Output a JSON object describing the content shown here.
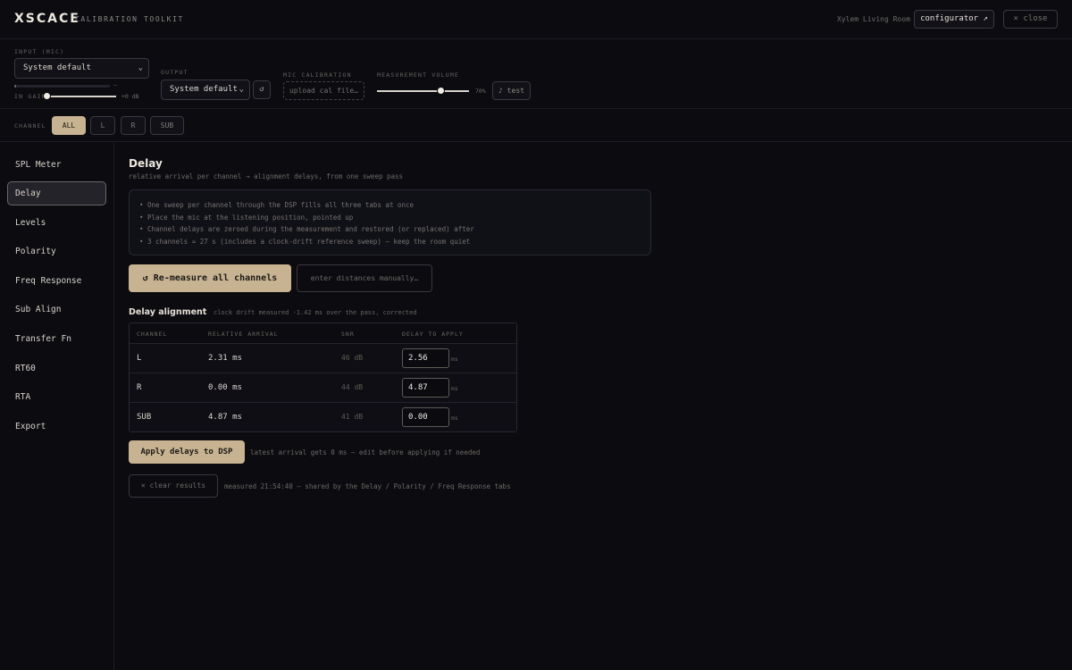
{
  "header": {
    "logo": "XSCACE",
    "subtitle": "CALIBRATION TOOLKIT",
    "room": "Xylem Living Room",
    "configurator_label": "configurator ↗",
    "close_label": "× close"
  },
  "controls": {
    "input_label": "INPUT (MIC)",
    "input_value": "System default",
    "input_meter_fraction": 0.02,
    "input_meter_dash": "—",
    "in_gain_label": "IN GAIN",
    "in_gain_value": "+0 dB",
    "output_label": "OUTPUT",
    "output_value": "System default",
    "refresh_icon": "↺",
    "mic_cal_label": "MIC CALIBRATION",
    "mic_cal_button": "upload cal file…",
    "volume_label": "MEASUREMENT VOLUME",
    "volume_value": "70%",
    "volume_fraction": 0.7,
    "test_label": "♪ test"
  },
  "channels": {
    "label": "CHANNEL",
    "items": [
      "ALL",
      "L",
      "R",
      "SUB"
    ],
    "active": "ALL"
  },
  "sidebar": {
    "items": [
      "SPL Meter",
      "Delay",
      "Levels",
      "Polarity",
      "Freq Response",
      "Sub Align",
      "Transfer Fn",
      "RT60",
      "RTA",
      "Export"
    ],
    "active": "Delay"
  },
  "main": {
    "title": "Delay",
    "subtitle": "relative arrival per channel → alignment delays, from one sweep pass",
    "info": [
      "• One sweep per channel through the DSP fills all three tabs at once",
      "• Place the mic at the listening position, pointed up",
      "• Channel delays are zeroed during the measurement and restored (or replaced) after",
      "• 3 channels ≈ 27 s (includes a clock-drift reference sweep) — keep the room quiet"
    ],
    "remeasure_label": "↺ Re-measure all channels",
    "manual_label": "enter distances manually…",
    "alignment_title": "Delay alignment",
    "alignment_note": "clock drift measured -1.42 ms over the pass, corrected",
    "table": {
      "headers": [
        "CHANNEL",
        "RELATIVE ARRIVAL",
        "SNR",
        "DELAY TO APPLY"
      ],
      "rows": [
        {
          "channel": "L",
          "arrival": "2.31 ms",
          "snr": "46 dB",
          "delay": "2.56",
          "unit": "ms"
        },
        {
          "channel": "R",
          "arrival": "0.00 ms",
          "snr": "44 dB",
          "delay": "4.87",
          "unit": "ms"
        },
        {
          "channel": "SUB",
          "arrival": "4.87 ms",
          "snr": "41 dB",
          "delay": "0.00",
          "unit": "ms"
        }
      ]
    },
    "apply_label": "Apply delays to DSP",
    "apply_note": "latest arrival gets 0 ms — edit before applying if needed",
    "clear_label": "× clear results",
    "clear_note": "measured 21:54:40 — shared by the Delay / Polarity / Freq Response tabs"
  }
}
